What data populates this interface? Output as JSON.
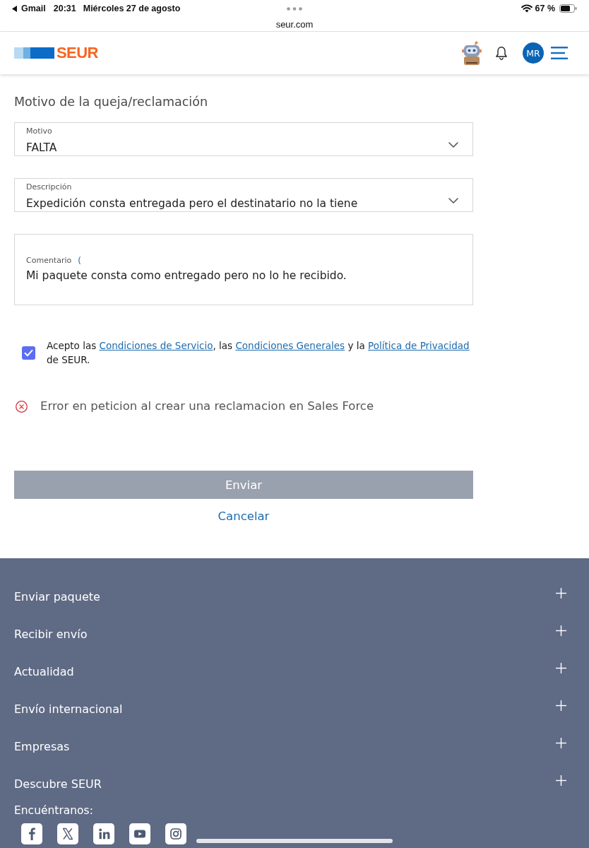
{
  "status_bar": {
    "back_app": "Gmail",
    "time": "20:31",
    "date": "Miércoles 27 de agosto",
    "battery": "67 %"
  },
  "address_bar": {
    "url": "seur.com"
  },
  "header": {
    "logo": "SEUR",
    "avatar": "MR"
  },
  "form": {
    "title": "Motivo de la queja/reclamación",
    "fields": [
      {
        "kind": "select",
        "label": "Motivo",
        "value": "FALTA"
      },
      {
        "kind": "select",
        "label": "Descripción",
        "value": "Expedición consta entregada pero el destinatario no la tiene"
      },
      {
        "kind": "textarea",
        "label": "Comentario",
        "label_note": "(",
        "value": "Mi paquete consta como entregado pero no lo he recibido."
      }
    ],
    "terms": {
      "checked": true,
      "parts": [
        {
          "kind": "text",
          "text": "Acepto las "
        },
        {
          "kind": "link",
          "text": "Condiciones de Servicio"
        },
        {
          "kind": "text",
          "text": ", las "
        },
        {
          "kind": "link",
          "text": "Condiciones Generales"
        },
        {
          "kind": "text",
          "text": " y la "
        },
        {
          "kind": "link",
          "text": "Política de Privacidad"
        },
        {
          "kind": "text",
          "text": " de SEUR."
        }
      ]
    },
    "error": {
      "message": "Error en peticion al crear una reclamacion en Sales Force"
    },
    "actions": {
      "submit": {
        "label": "Enviar",
        "disabled": true
      },
      "cancel": "Cancelar"
    }
  },
  "footer": {
    "sections": [
      {
        "label": "Enviar paquete",
        "expanded": false
      },
      {
        "label": "Recibir envío",
        "expanded": false
      },
      {
        "label": "Actualidad",
        "expanded": false
      },
      {
        "label": "Envío internacional",
        "expanded": false
      },
      {
        "label": "Empresas",
        "expanded": false
      },
      {
        "label": "Descubre SEUR",
        "expanded": false
      }
    ],
    "social_title": "Encuéntranos:"
  }
}
